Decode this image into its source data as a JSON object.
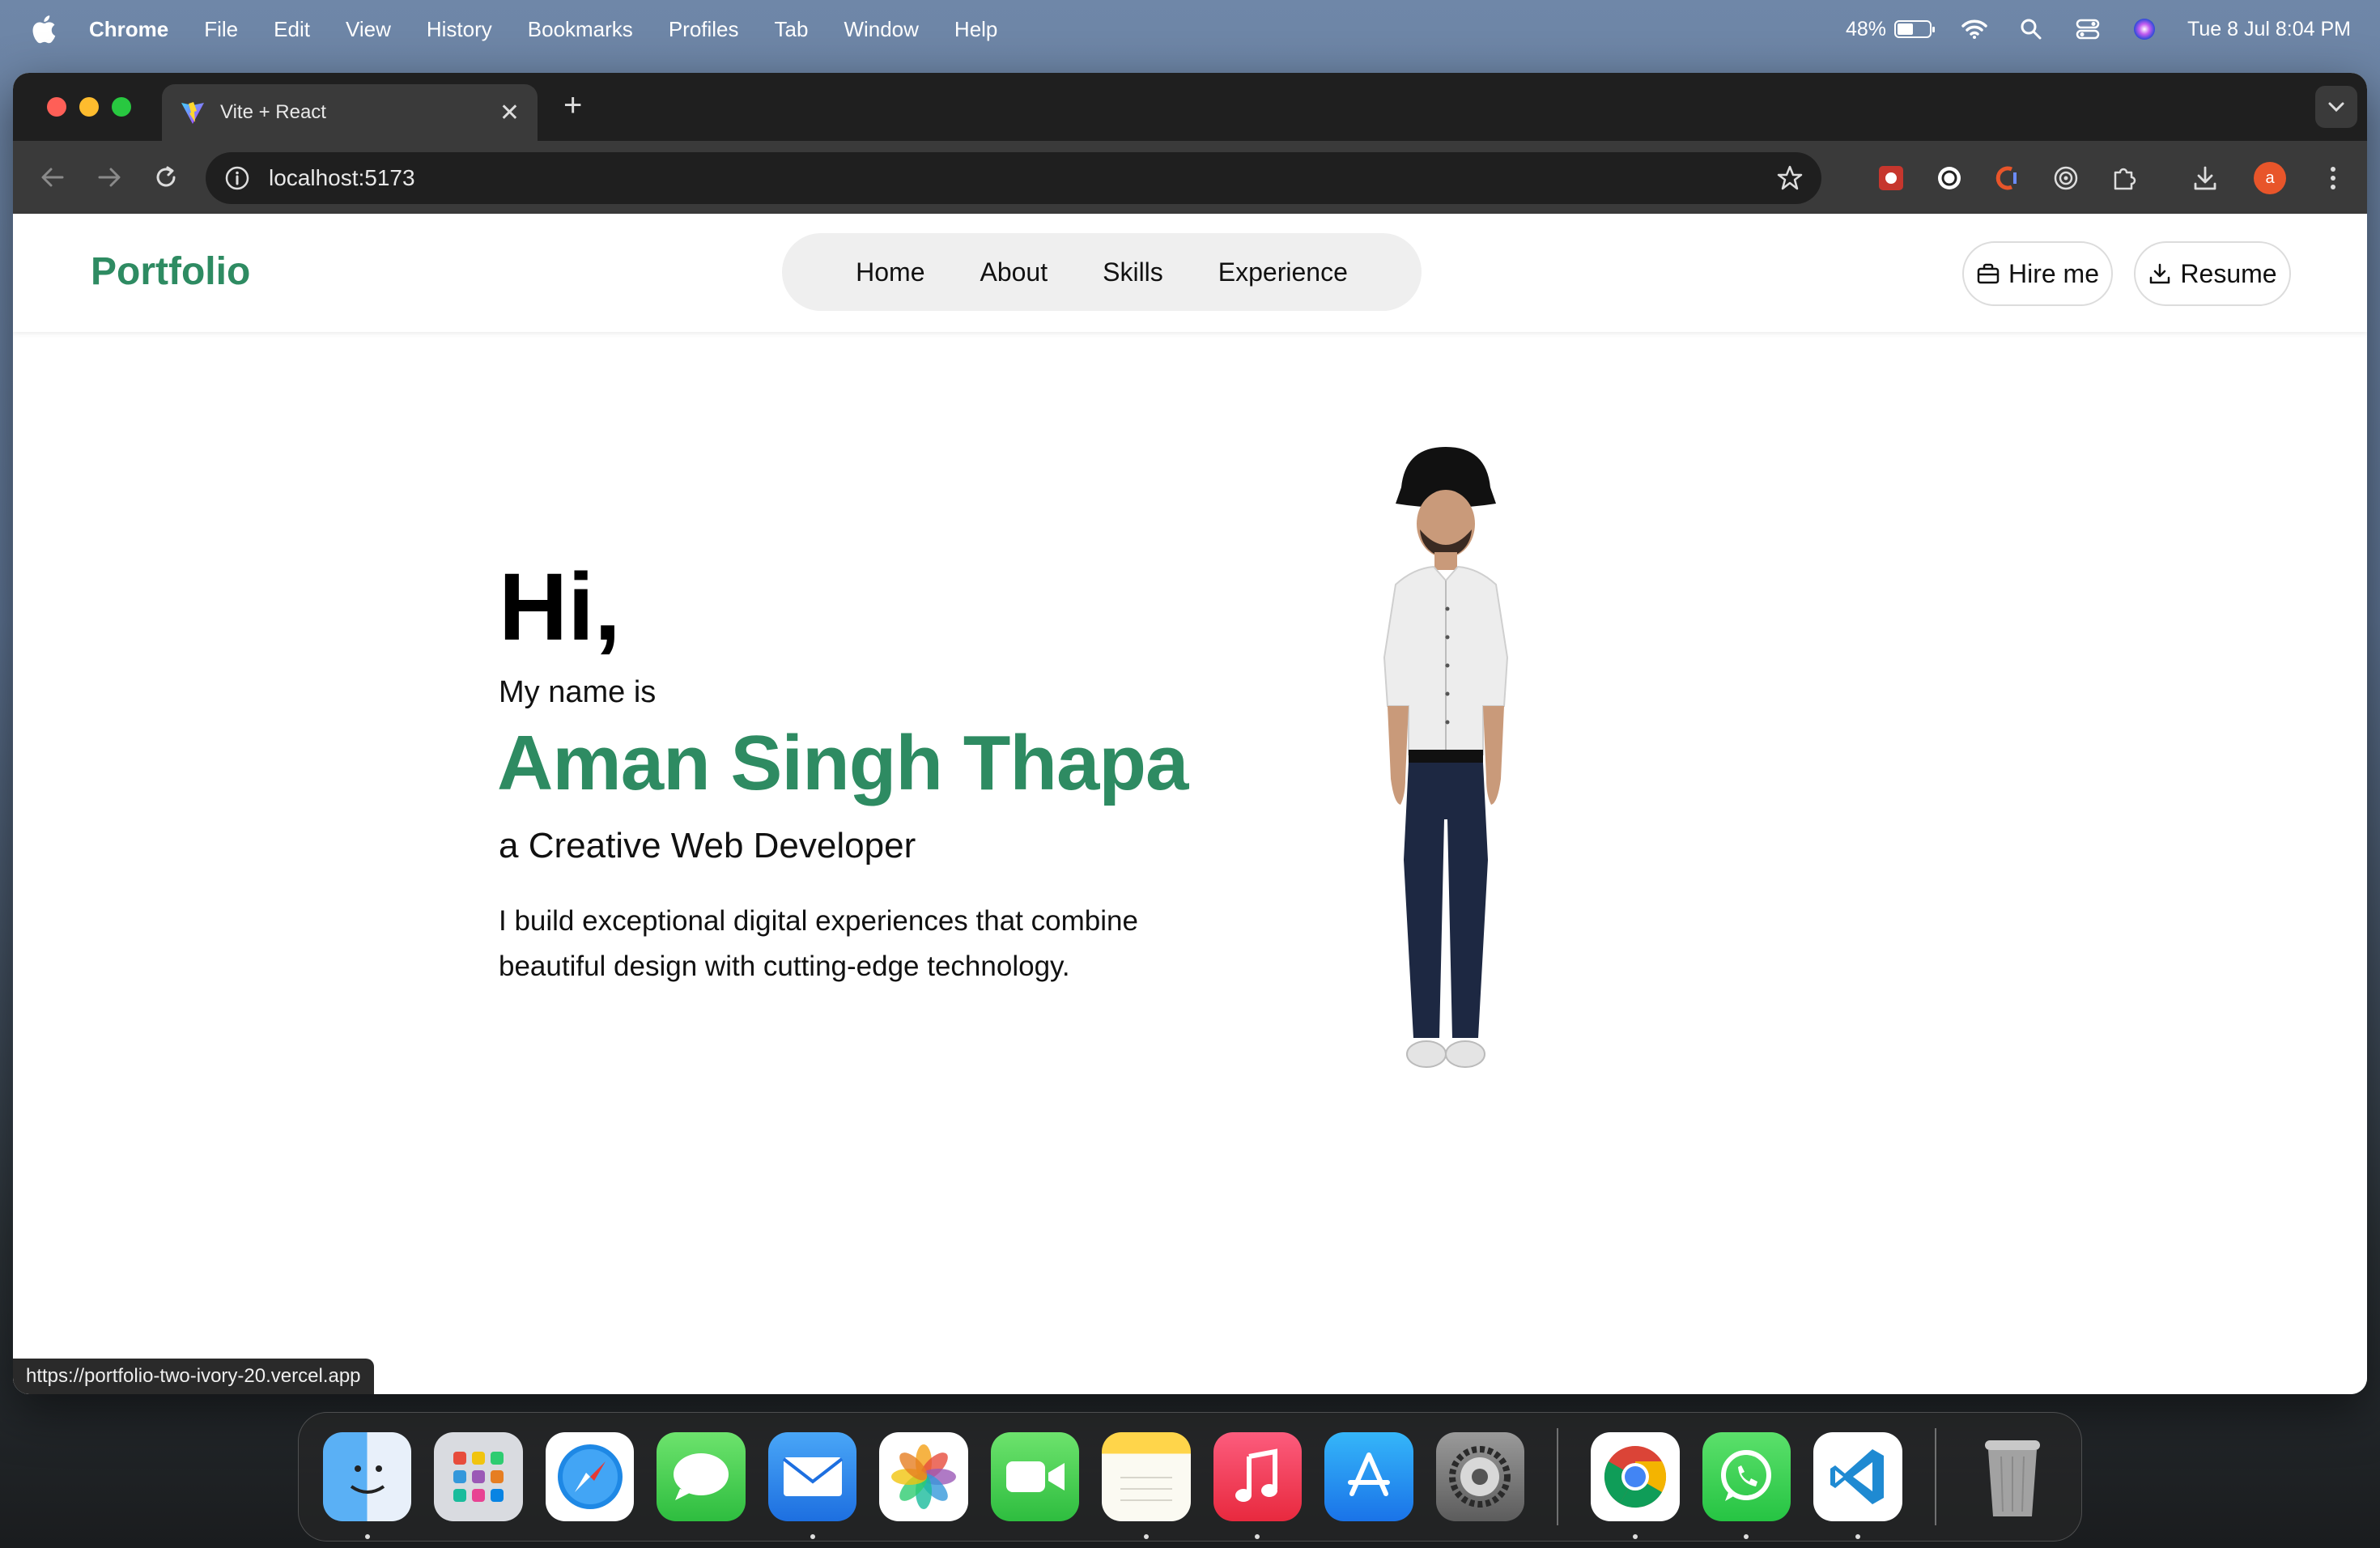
{
  "menubar": {
    "app": "Chrome",
    "items": [
      "File",
      "Edit",
      "View",
      "History",
      "Bookmarks",
      "Profiles",
      "Tab",
      "Window",
      "Help"
    ],
    "battery": "48%",
    "datetime": "Tue 8 Jul  8:04 PM"
  },
  "browser": {
    "tab_title": "Vite + React",
    "url": "localhost:5173",
    "profile_initial": "a",
    "status_url": "https://portfolio-two-ivory-20.vercel.app"
  },
  "site": {
    "logo": "Portfolio",
    "nav": [
      "Home",
      "About",
      "Skills",
      "Experience"
    ],
    "hire_label": "Hire me",
    "resume_label": "Resume"
  },
  "hero": {
    "greeting": "Hi,",
    "intro": "My name is",
    "name": "Aman Singh Thapa",
    "role": "a Creative Web Developer",
    "description": "I build exceptional digital experiences that combine beautiful design with cutting-edge technology."
  },
  "colors": {
    "accent": "#2e8b62"
  },
  "dock": {
    "apps": [
      "finder-icon",
      "launchpad-icon",
      "safari-icon",
      "messages-icon",
      "mail-icon",
      "photos-icon",
      "facetime-icon",
      "notes-icon",
      "music-icon",
      "app-store-icon",
      "system-settings-icon",
      "chrome-icon",
      "whatsapp-icon",
      "vscode-icon",
      "trash-icon"
    ]
  }
}
